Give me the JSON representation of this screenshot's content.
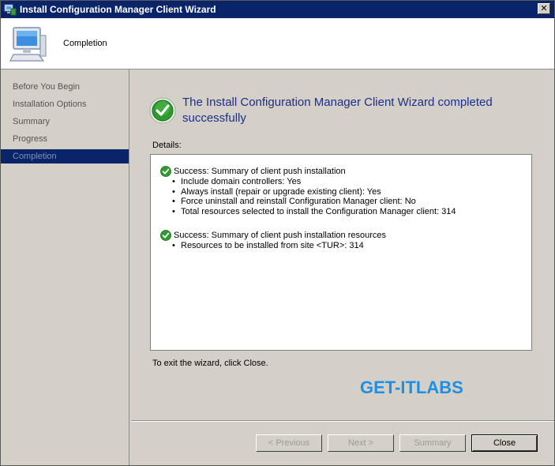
{
  "window": {
    "title": "Install Configuration Manager Client Wizard",
    "close_glyph": "✕",
    "icons": [
      "app-icon",
      "computer-icon",
      "success-check-icon"
    ]
  },
  "header": {
    "title": "Completion"
  },
  "sidebar": {
    "items": [
      {
        "label": "Before You Begin"
      },
      {
        "label": "Installation Options"
      },
      {
        "label": "Summary"
      },
      {
        "label": "Progress"
      },
      {
        "label": "Completion",
        "active": true
      }
    ]
  },
  "main": {
    "headline": "The Install Configuration Manager Client Wizard completed successfully",
    "details_label": "Details:",
    "sections": [
      {
        "title": "Success: Summary of client push installation",
        "items": [
          "Include domain controllers: Yes",
          "Always install (repair or upgrade existing client): Yes",
          "Force uninstall and reinstall Configuration Manager client: No",
          "Total resources selected to install the Configuration Manager client:  314"
        ]
      },
      {
        "title": "Success: Summary of client push installation resources",
        "items": [
          "Resources to be installed from site <TUR>: 314"
        ]
      }
    ],
    "exit_text": "To exit the wizard, click Close.",
    "watermark": "GET-ITLABS"
  },
  "buttons": {
    "previous": "< Previous",
    "next": "Next >",
    "summary": "Summary",
    "close": "Close"
  },
  "colors": {
    "title_bar": "#0a246a",
    "headline": "#1c2e8c",
    "watermark": "#1e8fe6",
    "success": "#2e9b2e"
  }
}
